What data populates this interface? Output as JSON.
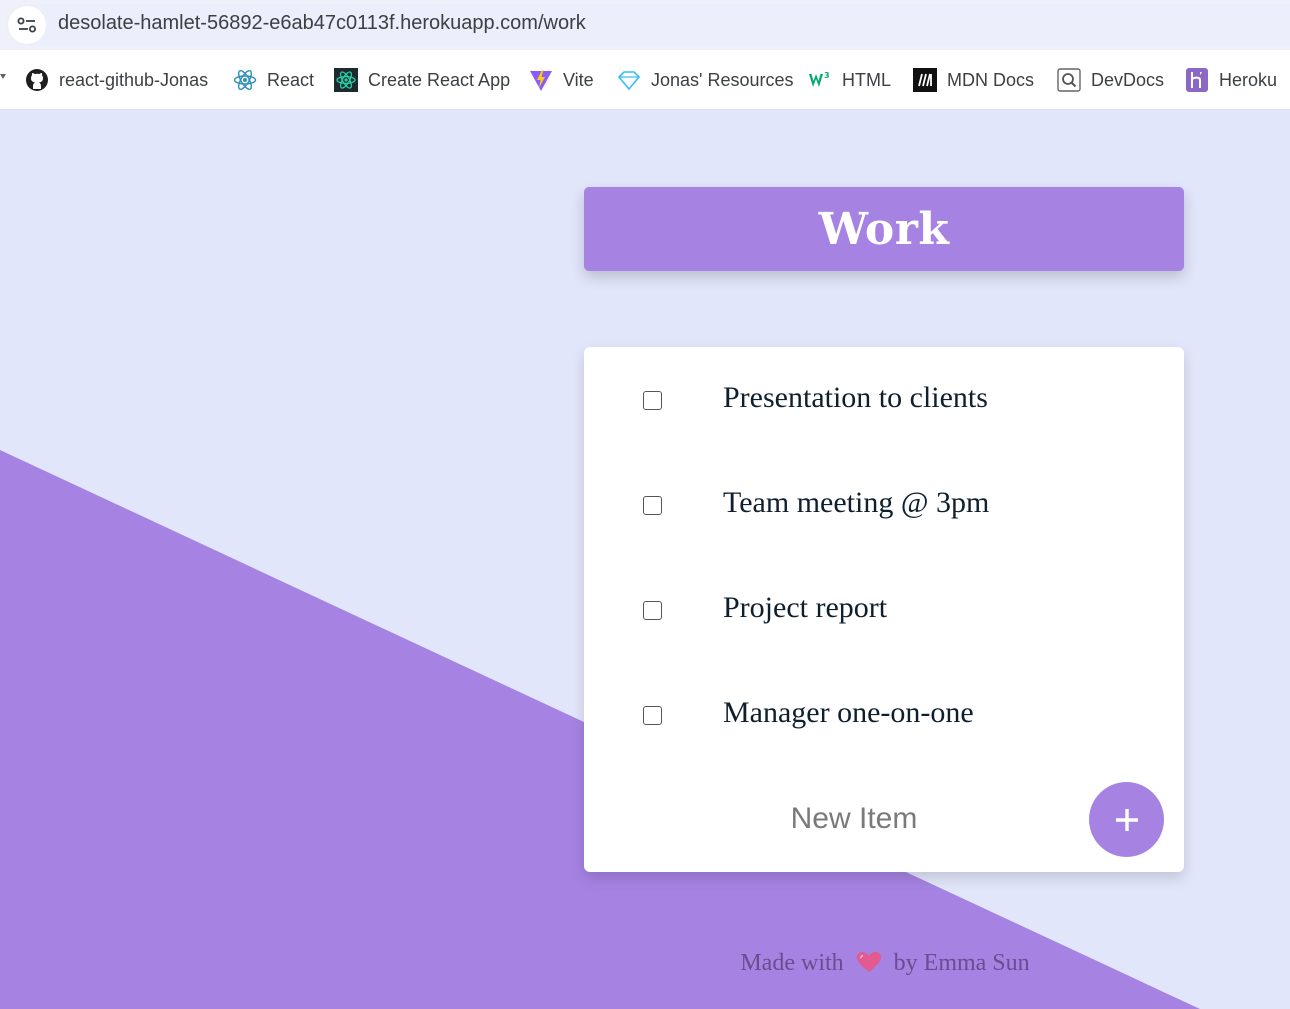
{
  "browser": {
    "url": "desolate-hamlet-56892-e6ab47c0113f.herokuapp.com/work",
    "bookmarks": [
      {
        "label": "react-github-Jonas",
        "icon": "github-icon"
      },
      {
        "label": "React",
        "icon": "react-icon"
      },
      {
        "label": "Create React App",
        "icon": "create-react-app-icon"
      },
      {
        "label": "Vite",
        "icon": "vite-icon"
      },
      {
        "label": "Jonas' Resources",
        "icon": "diamond-icon"
      },
      {
        "label": "HTML",
        "icon": "w3schools-icon"
      },
      {
        "label": "MDN Docs",
        "icon": "mdn-icon"
      },
      {
        "label": "DevDocs",
        "icon": "devdocs-icon"
      },
      {
        "label": "Heroku",
        "icon": "heroku-icon"
      }
    ]
  },
  "page": {
    "title": "Work",
    "items": [
      {
        "text": "Presentation to clients",
        "checked": false
      },
      {
        "text": "Team meeting @ 3pm",
        "checked": false
      },
      {
        "text": "Project report",
        "checked": false
      },
      {
        "text": "Manager one-on-one",
        "checked": false
      }
    ],
    "new_item_placeholder": "New Item",
    "add_button_label": "+",
    "footer": {
      "prefix": "Made with",
      "suffix": "by Emma Sun"
    }
  },
  "colors": {
    "accent": "#a683e3",
    "background": "#e2e6fa",
    "card": "#ffffff"
  }
}
